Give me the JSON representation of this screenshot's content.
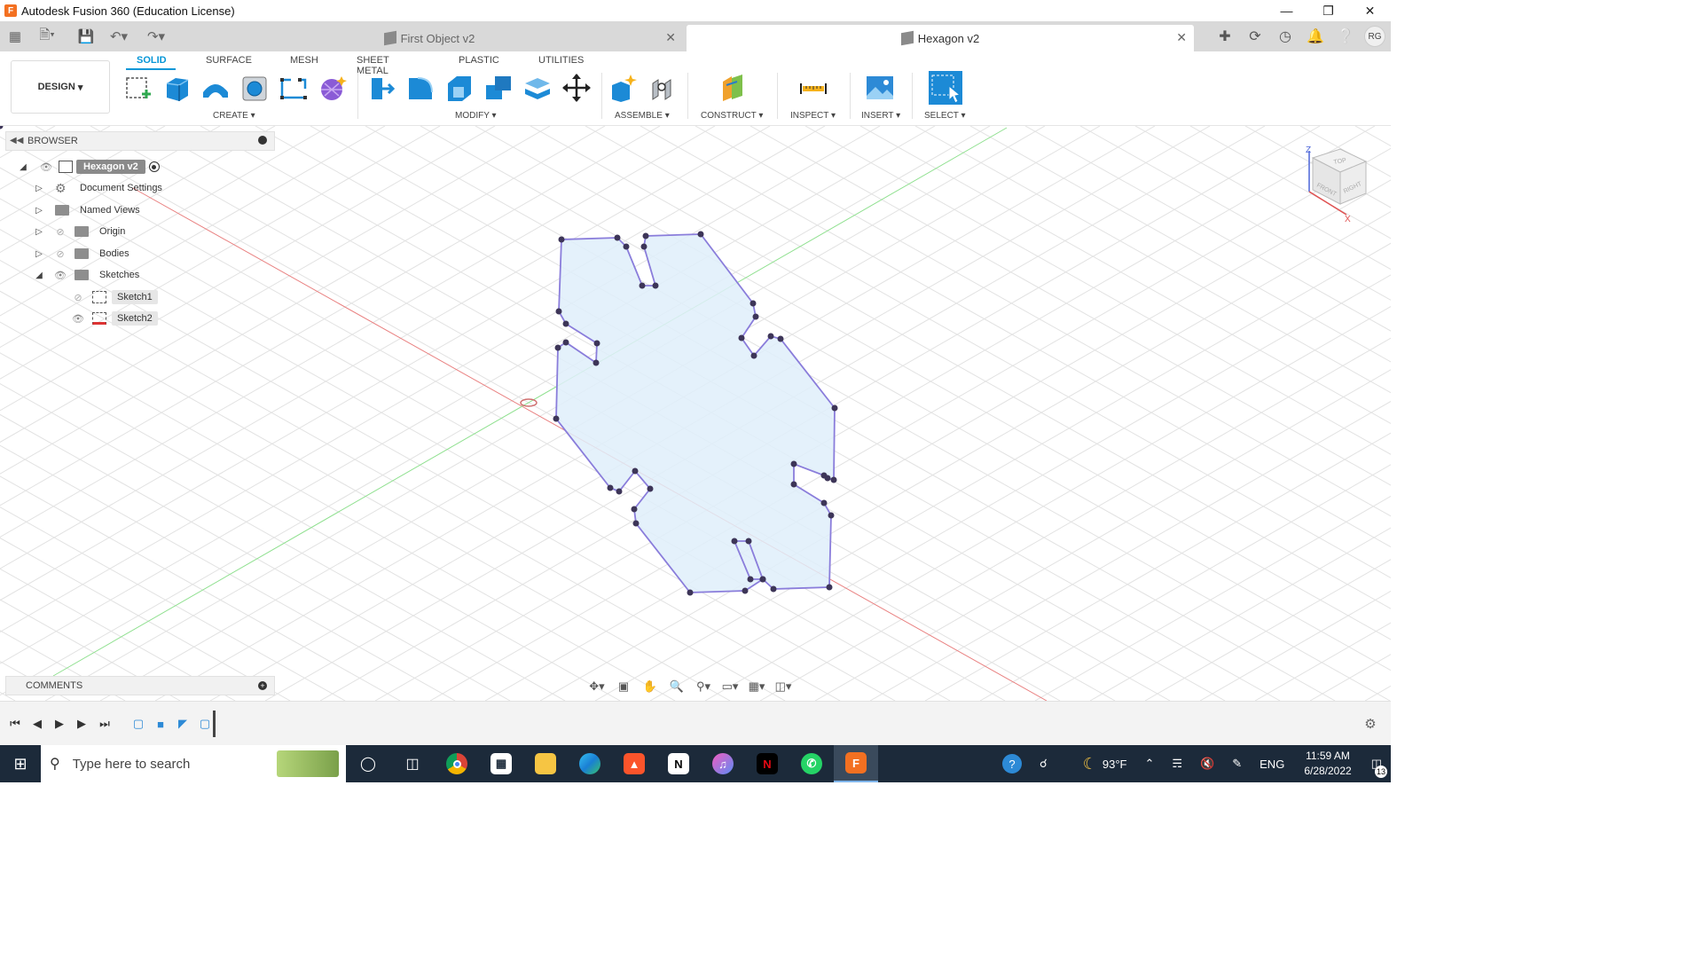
{
  "window": {
    "title": "Autodesk Fusion 360 (Education License)",
    "controls": [
      "minimize",
      "restore",
      "close"
    ]
  },
  "tabs": [
    {
      "label": "First Object v2",
      "active": false
    },
    {
      "label": "Hexagon v2",
      "active": true
    }
  ],
  "account": {
    "initials": "RG"
  },
  "toolbar": {
    "workspace": "DESIGN",
    "workspace_tabs": [
      "SOLID",
      "SURFACE",
      "MESH",
      "SHEET METAL",
      "PLASTIC",
      "UTILITIES"
    ],
    "active_workspace_tab": "SOLID",
    "groups": {
      "create": "CREATE",
      "modify": "MODIFY",
      "assemble": "ASSEMBLE",
      "construct": "CONSTRUCT",
      "inspect": "INSPECT",
      "insert": "INSERT",
      "select": "SELECT"
    }
  },
  "browser": {
    "title": "BROWSER",
    "root": "Hexagon v2",
    "items": [
      {
        "label": "Document Settings",
        "icon": "gear-icon"
      },
      {
        "label": "Named Views",
        "icon": "folder-icon"
      },
      {
        "label": "Origin",
        "icon": "folder-icon",
        "hidden": true
      },
      {
        "label": "Bodies",
        "icon": "folder-icon",
        "hidden": true
      },
      {
        "label": "Sketches",
        "icon": "folder-icon",
        "expanded": true
      }
    ],
    "sketches": [
      {
        "label": "Sketch1",
        "hidden": true
      },
      {
        "label": "Sketch2",
        "hidden": false
      }
    ]
  },
  "comments": {
    "title": "COMMENTS"
  },
  "viewcube": {
    "top": "TOP",
    "front": "FRONT",
    "right": "RIGHT",
    "axis_z": "Z",
    "axis_x": "X"
  },
  "colors": {
    "accent": "#0696d7",
    "sketch_line": "#8a7ddb",
    "sketch_fill": "#dfeefa",
    "x_axis": "#e06060",
    "y_axis": "#7fd97f",
    "taskbar": "#1c2a3a"
  },
  "taskbar": {
    "search_placeholder": "Type here to search",
    "apps": [
      "cortana",
      "task-view",
      "chrome",
      "store",
      "file-explorer",
      "edge",
      "brave",
      "notion",
      "itunes",
      "netflix",
      "whatsapp",
      "fusion360"
    ],
    "weather": "93°F",
    "language": "ENG",
    "time": "11:59 AM",
    "date": "6/28/2022",
    "notifications": "13"
  }
}
